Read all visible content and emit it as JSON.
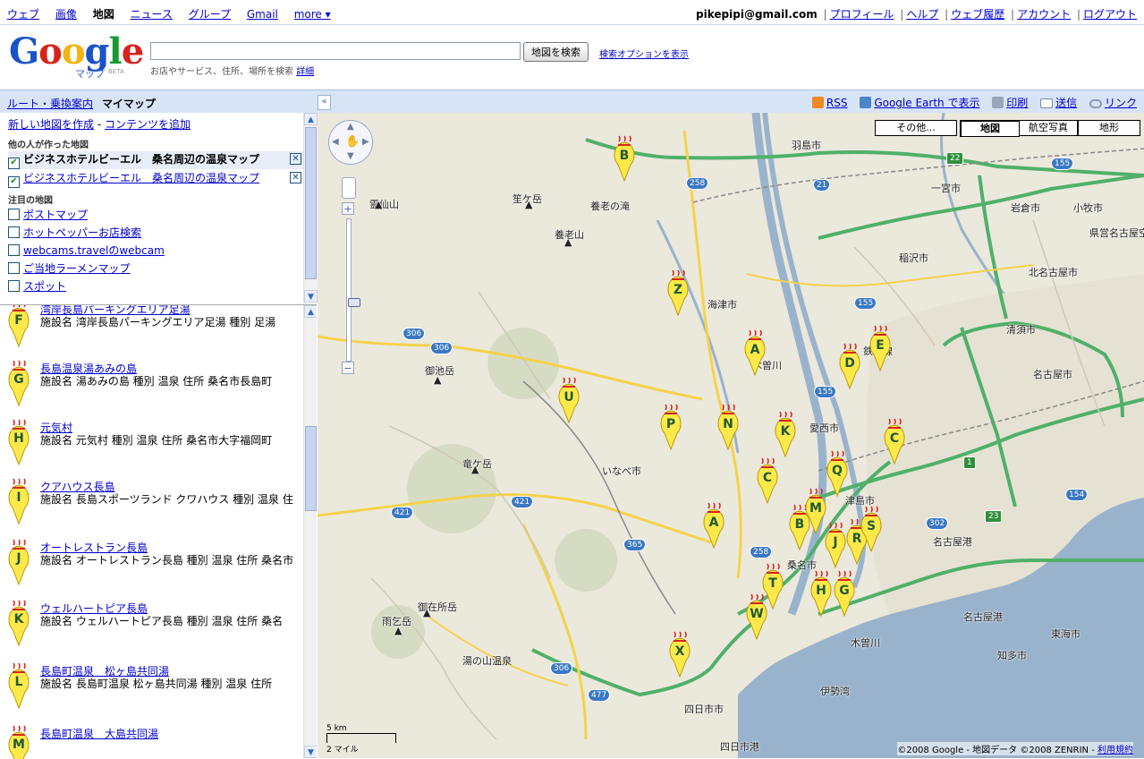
{
  "top_nav": {
    "links": [
      "ウェブ",
      "画像",
      "地図",
      "ニュース",
      "グループ",
      "Gmail",
      "more ▾"
    ],
    "active": "地図",
    "user_email": "pikepipi@gmail.com",
    "account_links": [
      "プロフィール",
      "ヘルプ",
      "ウェブ履歴",
      "アカウント",
      "ログアウト"
    ]
  },
  "header": {
    "logo_text": "Google",
    "logo_sub": "マップ",
    "logo_beta": "BETA",
    "search_placeholder": "",
    "search_button": "地図を検索",
    "search_options": "検索オプションを表示",
    "hint_text": "お店やサービス、住所、場所を検索",
    "hint_link": "詳細"
  },
  "bluebar": {
    "tab_route": "ルート・乗換案内",
    "tab_mymap": "マイマップ",
    "collapse": "«",
    "tools": {
      "rss": "RSS",
      "earth": "Google Earth で表示",
      "print": "印刷",
      "send": "送信",
      "link": "リンク"
    }
  },
  "sidebar": {
    "new_map": "新しい地図を作成",
    "separator": "-",
    "add_content": "コンテンツを追加",
    "others_heading": "他の人が作った地図",
    "others_maps": [
      {
        "label": "ビジネスホテルビーエル　桑名周辺の温泉マップ",
        "checked": true,
        "bold": true
      },
      {
        "label": "ビジネスホテルビーエル　桑名周辺の温泉マップ",
        "checked": true,
        "bold": false
      }
    ],
    "featured_heading": "注目の地図",
    "featured_maps": [
      "ポストマップ",
      "ホットペッパーお店検索",
      "webcams.travelのwebcam",
      "ご当地ラーメンマップ",
      "スポット"
    ],
    "list_items": [
      {
        "letter": "F",
        "title": "湾岸長島パーキングエリア足湯",
        "desc": "施設名 湾岸長島パーキングエリア足湯 種別 足湯"
      },
      {
        "letter": "G",
        "title": "長島温泉湯あみの島",
        "desc": "施設名 湯あみの島 種別 温泉 住所 桑名市長島町"
      },
      {
        "letter": "H",
        "title": "元気村",
        "desc": "施設名 元気村 種別 温泉 住所 桑名市大字福岡町"
      },
      {
        "letter": "I",
        "title": "クアハウス長島",
        "desc": "施設名 長島スポーツランド クワハウス 種別 温泉 住"
      },
      {
        "letter": "J",
        "title": "オートレストラン長島",
        "desc": "施設名 オートレストラン長島 種別 温泉 住所 桑名市"
      },
      {
        "letter": "K",
        "title": "ウェルハートピア長島",
        "desc": "施設名 ウェルハートピア長島 種別 温泉 住所 桑名"
      },
      {
        "letter": "L",
        "title": "長島町温泉　松ヶ島共同湯",
        "desc": "施設名 長島町温泉 松ヶ島共同湯 種別 温泉 住所"
      },
      {
        "letter": "M",
        "title": "長島町温泉　大島共同湯",
        "desc": ""
      }
    ]
  },
  "map": {
    "map_types": {
      "more": "その他...",
      "map": "地図",
      "satellite": "航空写真",
      "terrain": "地形"
    },
    "zoom_in": "+",
    "zoom_out": "−",
    "places": [
      "羽島市",
      "一宮市",
      "岩倉市",
      "小牧市",
      "県営名古屋空港",
      "稲沢市",
      "北名古屋市",
      "清須市",
      "名古屋市",
      "海津市",
      "木曽川",
      "愛西市",
      "津島市",
      "桑名市",
      "いなべ市",
      "四日市市",
      "四日市港",
      "伊勢湾",
      "名古屋港",
      "東海市",
      "知多市",
      "木曽川",
      "養老の滝",
      "養老山",
      "笙ケ岳",
      "霊仙山",
      "御池岳",
      "竜ケ岳",
      "御在所岳",
      "雨乞岳",
      "湯の山温泉",
      "鉄道線",
      "名古屋港"
    ],
    "pins": [
      "B",
      "Z",
      "A",
      "D",
      "E",
      "U",
      "P",
      "N",
      "K",
      "C",
      "C",
      "Q",
      "A",
      "B",
      "M",
      "J",
      "R",
      "S",
      "T",
      "H",
      "G",
      "W",
      "X"
    ],
    "scale_km": "5 km",
    "scale_mile": "2 マイル",
    "copyright": "©2008 Google - 地図データ ©2008 ZENRIN - ",
    "terms": "利用規約"
  }
}
